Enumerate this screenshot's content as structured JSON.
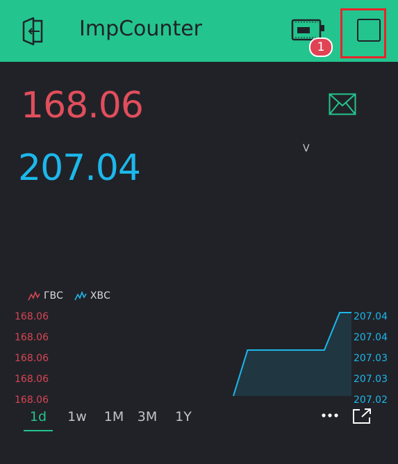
{
  "header": {
    "title": "ImpCounter",
    "badge_count": "1",
    "back_icon": "exit-arrow-icon",
    "device_icon": "device-status-icon",
    "square_icon": "square-outline-icon"
  },
  "values": {
    "hot": "168.06",
    "cold": "207.04",
    "v_label": "V"
  },
  "legend": [
    {
      "name": "ГВС",
      "color": "#d74656"
    },
    {
      "name": "ХВС",
      "color": "#1cb8ec"
    }
  ],
  "tabs": [
    {
      "label": "1d",
      "active": true
    },
    {
      "label": "1w",
      "active": false
    },
    {
      "label": "1M",
      "active": false
    },
    {
      "label": "3M",
      "active": false
    },
    {
      "label": "1Y",
      "active": false
    }
  ],
  "chart_data": {
    "type": "area",
    "left_axis_ticks": [
      "168.06",
      "168.06",
      "168.06",
      "168.06",
      "168.06"
    ],
    "right_axis_ticks": [
      "207.04",
      "207.04",
      "207.03",
      "207.03",
      "207.02"
    ],
    "series": [
      {
        "name": "ХВС",
        "color": "#1cb8ec",
        "points": [
          [
            0,
            207.02
          ],
          [
            0.12,
            207.031
          ],
          [
            0.77,
            207.031
          ],
          [
            0.9,
            207.04
          ],
          [
            1,
            207.04
          ]
        ]
      }
    ],
    "ylim": [
      207.02,
      207.04
    ]
  },
  "colors": {
    "accent": "#24c48e",
    "background": "#212227",
    "hot": "#e14e5c",
    "cold": "#1cb8ec"
  }
}
